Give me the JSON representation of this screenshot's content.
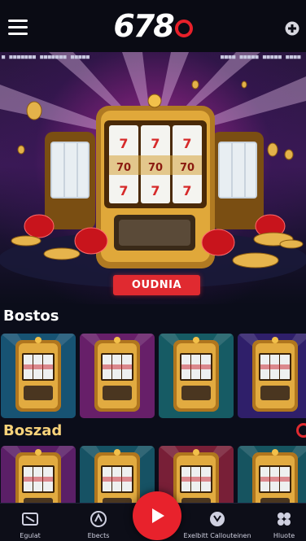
{
  "header": {
    "logo_text": "678",
    "menu_icon": "hamburger-menu-icon",
    "plus_icon": "plus-icon",
    "accent": "#e8202a"
  },
  "hero": {
    "ticker_left": "■ ■■■■■■■ ■■■■■■■ ■■■■■",
    "ticker_right": "■■■■ ■■■■■ ■■■■■ ■■■■",
    "cta_label": "OUDNIA",
    "reel_symbols": [
      "7",
      "7",
      "7",
      "70",
      "70",
      "70",
      "7",
      "7",
      "7"
    ]
  },
  "sections": [
    {
      "title": "Bostos"
    },
    {
      "title": "Boszad"
    }
  ],
  "tiles_row1": [
    {
      "bg": "#1f6f9a"
    },
    {
      "bg": "#8a2a8c"
    },
    {
      "bg": "#1e7a86"
    },
    {
      "bg": "#3f2a8e"
    }
  ],
  "tiles_row2": [
    {
      "bg": "#7a2a8a"
    },
    {
      "bg": "#1e6e86"
    },
    {
      "bg": "#a02a4a"
    },
    {
      "bg": "#1e7080"
    }
  ],
  "bottom_nav": {
    "items": [
      {
        "label": "Egulat",
        "icon": "slots-icon"
      },
      {
        "label": "Ebects",
        "icon": "sports-icon"
      },
      {
        "label": "Exelbitt Callouteinen",
        "icon": "promotions-icon"
      },
      {
        "label": "Hluote",
        "icon": "more-icon"
      }
    ],
    "play_icon": "play-icon"
  }
}
